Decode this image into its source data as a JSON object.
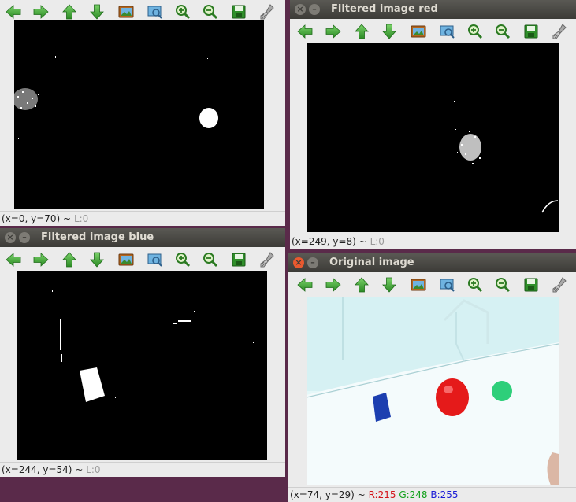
{
  "windows": {
    "top_left": {
      "title": "",
      "status": {
        "coords": "(x=0, y=70)",
        "sep": "~",
        "level": "L:0"
      }
    },
    "red": {
      "title": "Filtered image red",
      "status": {
        "coords": "(x=249, y=8)",
        "sep": "~",
        "level": "L:0"
      }
    },
    "blue": {
      "title": "Filtered image blue",
      "status": {
        "coords": "(x=244, y=54)",
        "sep": "~",
        "level": "L:0"
      }
    },
    "original": {
      "title": "Original image",
      "status": {
        "coords": "(x=74, y=29)",
        "sep": "~",
        "r": "R:215",
        "g": "G:248",
        "b": "B:255"
      }
    }
  },
  "toolbar_icons": [
    "pan-left-icon",
    "pan-right-icon",
    "pan-up-icon",
    "pan-down-icon",
    "zoom-image-icon",
    "zoom-region-icon",
    "zoom-in-icon",
    "zoom-out-icon",
    "save-icon",
    "properties-icon"
  ],
  "colors": {
    "titlebar": "#3c3b37",
    "toolbar": "#ebebeb",
    "arrow_green": "#3aa53a",
    "desktop": "#5a2a4a"
  }
}
